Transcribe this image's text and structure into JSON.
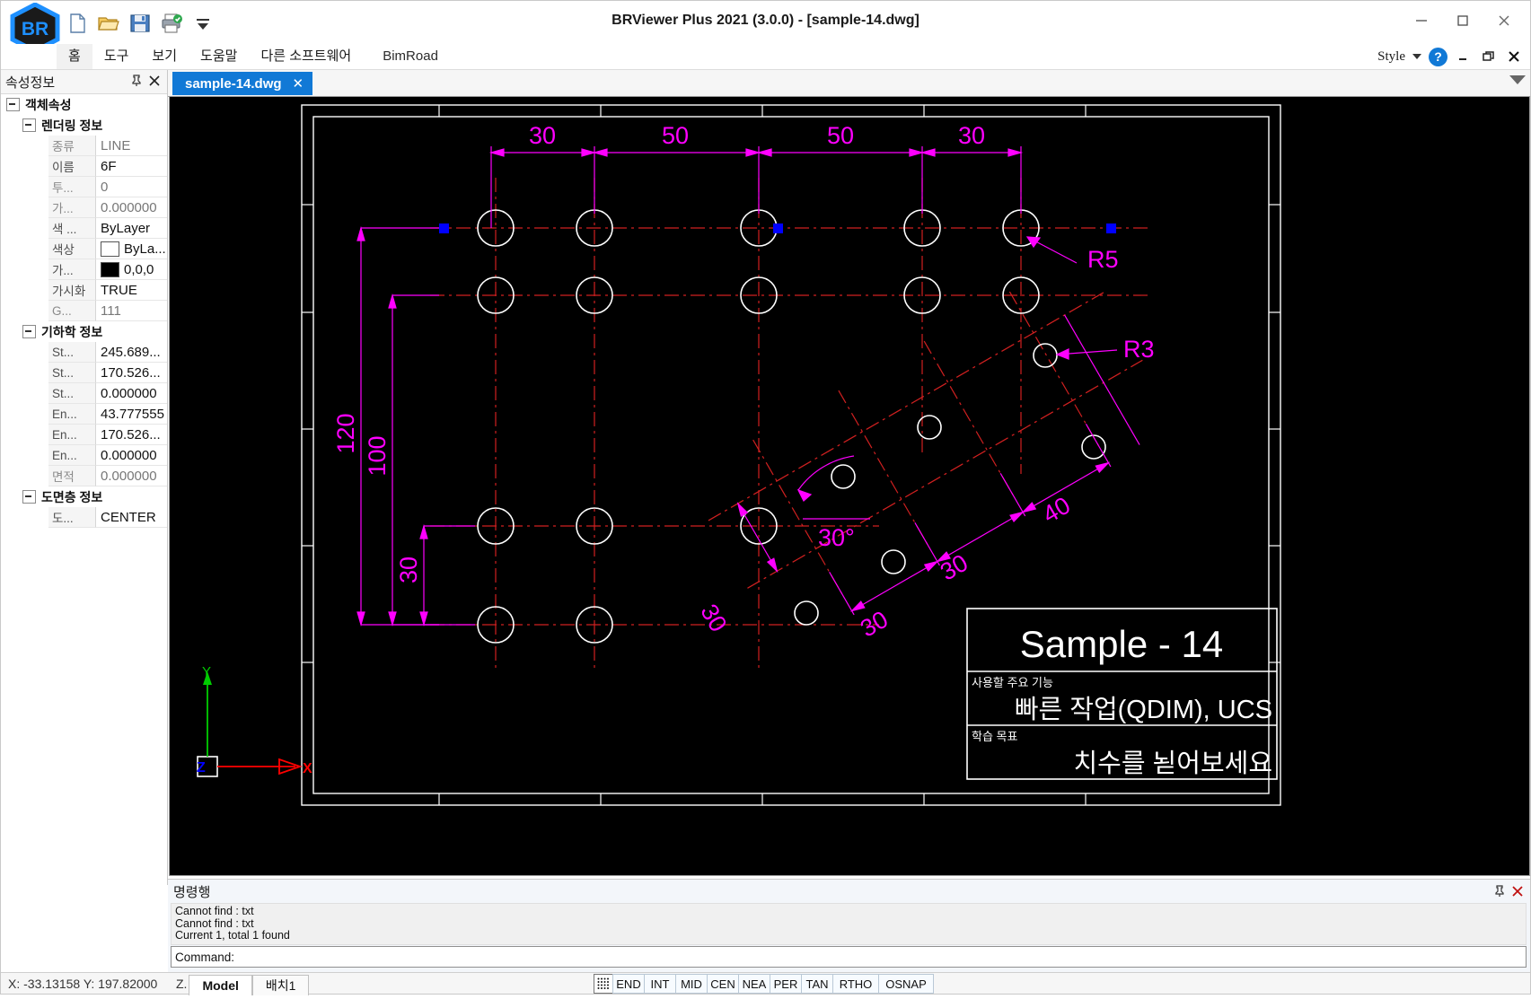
{
  "window": {
    "title": "BRViewer Plus 2021 (3.0.0) - [sample-14.dwg]",
    "minimize": "—",
    "maximize": "□",
    "close": "✕"
  },
  "quick_access": [
    "new-file-icon",
    "open-folder-icon",
    "save-icon",
    "print-icon",
    "more-commands-icon"
  ],
  "menu": {
    "items": [
      {
        "label": "홈",
        "active": true
      },
      {
        "label": "도구",
        "active": false
      },
      {
        "label": "보기",
        "active": false
      },
      {
        "label": "도움말",
        "active": false
      },
      {
        "label": "다른 소프트웨어",
        "active": false
      },
      {
        "label": "BimRoad",
        "active": false
      }
    ],
    "style_label": "Style",
    "help_label": "?",
    "min_label": "–",
    "restore_label": "❐",
    "close_label": "✕"
  },
  "properties_panel": {
    "title": "속성정보",
    "pin_icon": "pin-icon",
    "close_icon": "close-icon",
    "groups": [
      {
        "label": "객체속성",
        "level": 1,
        "rows": []
      },
      {
        "label": "렌더링 정보",
        "level": 2,
        "rows": [
          {
            "key": "종류",
            "value": "LINE",
            "dim": true
          },
          {
            "key": "이름",
            "value": "6F",
            "dim": false
          },
          {
            "key": "투...",
            "value": "0",
            "dim": true
          },
          {
            "key": "가...",
            "value": "0.000000",
            "dim": true
          },
          {
            "key": "색 ...",
            "value": "ByLayer",
            "dim": false
          },
          {
            "key": "색상",
            "value": "ByLa...",
            "dim": false,
            "swatch": "#ffffff"
          },
          {
            "key": "가...",
            "value": "0,0,0",
            "dim": false,
            "swatch": "#000000"
          },
          {
            "key": "가시화",
            "value": "TRUE",
            "dim": false
          },
          {
            "key": "G...",
            "value": "111",
            "dim": true
          }
        ]
      },
      {
        "label": "기하학 정보",
        "level": 2,
        "rows": [
          {
            "key": "St...",
            "value": "245.689...",
            "dim": false
          },
          {
            "key": "St...",
            "value": "170.526...",
            "dim": false
          },
          {
            "key": "St...",
            "value": "0.000000",
            "dim": false
          },
          {
            "key": "En...",
            "value": "43.777555",
            "dim": false
          },
          {
            "key": "En...",
            "value": "170.526...",
            "dim": false
          },
          {
            "key": "En...",
            "value": "0.000000",
            "dim": false
          },
          {
            "key": "면적",
            "value": "0.000000",
            "dim": true
          }
        ]
      },
      {
        "label": "도면층 정보",
        "level": 2,
        "rows": [
          {
            "key": "도...",
            "value": "CENTER",
            "dim": false
          }
        ]
      }
    ]
  },
  "document_tabs": {
    "active": "sample-14.dwg",
    "close_label": "✕",
    "dropdown_icon": "chevron-down-icon"
  },
  "command_panel": {
    "title": "명령행",
    "pin_icon": "pin-icon",
    "close_icon": "close-icon",
    "log": [
      "Cannot find : txt",
      "Cannot find : txt",
      "Current 1, total 1 found"
    ],
    "prompt": "Command:"
  },
  "status_bar": {
    "x_label": "X: -33.13158",
    "y_label": "Y: 197.82000",
    "z_label": "Z.",
    "space_tabs": [
      "Model",
      "배치1"
    ],
    "grid_icon": "grid-icon",
    "snaps": [
      "END",
      "INT",
      "MID",
      "CEN",
      "NEA",
      "PER",
      "TAN",
      "RTHO",
      "OSNAP"
    ]
  },
  "drawing": {
    "title_block": {
      "title": "Sample - 14",
      "feature_caption": "사용할 주요 기능",
      "feature_value": "빠른 작업(QDIM), UCS",
      "goal_caption": "학습 목표",
      "goal_value": "치수를 넣어보세요"
    },
    "dimensions_top": [
      "30",
      "50",
      "50",
      "30"
    ],
    "dimensions_left": [
      "120",
      "100",
      "30"
    ],
    "radii": [
      "R5",
      "R3"
    ],
    "angle": "30°",
    "dimensions_angled": [
      "30",
      "30",
      "30",
      "40"
    ],
    "ucs_axes": {
      "x": "X",
      "y": "Y",
      "z": "Z"
    },
    "colors": {
      "background": "#000000",
      "geometry": "#ffffff",
      "centerline": "#d02020",
      "dimension": "#ff00ff",
      "grip": "#0000ff",
      "axis_x": "#ff0000",
      "axis_y": "#00cc00"
    }
  }
}
